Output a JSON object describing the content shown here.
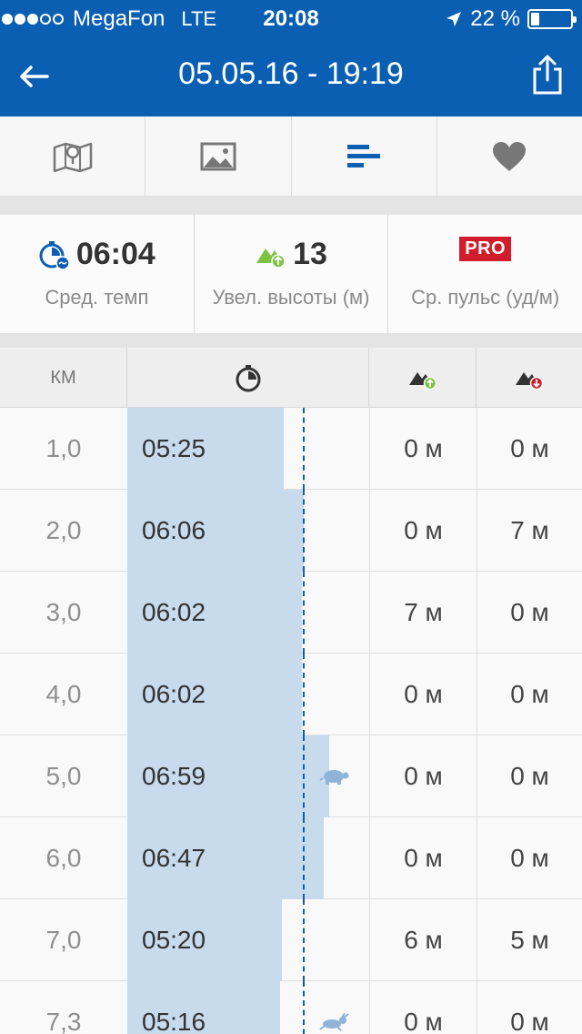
{
  "status_bar": {
    "carrier": "MegaFon",
    "network": "LTE",
    "time": "20:08",
    "battery_text": "22 %",
    "battery_level": 0.22,
    "signal_dots_filled": 3,
    "signal_dots_total": 5
  },
  "nav": {
    "title": "05.05.16 - 19:19",
    "back_icon": "back-arrow-icon",
    "share_icon": "share-icon"
  },
  "tabs": [
    {
      "icon": "map-icon",
      "active": false
    },
    {
      "icon": "photo-icon",
      "active": false
    },
    {
      "icon": "splits-icon",
      "active": true
    },
    {
      "icon": "heart-icon",
      "active": false
    }
  ],
  "summary": {
    "pace": {
      "value": "06:04",
      "label": "Сред. темп"
    },
    "elevation": {
      "value": "13",
      "label": "Увел. высоты (м)"
    },
    "heart_rate": {
      "badge": "PRO",
      "label": "Ср. пульс (уд/м)"
    }
  },
  "table": {
    "header_km": "КМ",
    "average_pace_seconds": 364,
    "rows": [
      {
        "km": "1,0",
        "pace": "05:25",
        "pace_seconds": 325,
        "up": "0 м",
        "down": "0 м",
        "marker": ""
      },
      {
        "km": "2,0",
        "pace": "06:06",
        "pace_seconds": 366,
        "up": "0 м",
        "down": "7 м",
        "marker": ""
      },
      {
        "km": "3,0",
        "pace": "06:02",
        "pace_seconds": 362,
        "up": "7 м",
        "down": "0 м",
        "marker": ""
      },
      {
        "km": "4,0",
        "pace": "06:02",
        "pace_seconds": 362,
        "up": "0 м",
        "down": "0 м",
        "marker": ""
      },
      {
        "km": "5,0",
        "pace": "06:59",
        "pace_seconds": 419,
        "up": "0 м",
        "down": "0 м",
        "marker": "turtle"
      },
      {
        "km": "6,0",
        "pace": "06:47",
        "pace_seconds": 407,
        "up": "0 м",
        "down": "0 м",
        "marker": ""
      },
      {
        "km": "7,0",
        "pace": "05:20",
        "pace_seconds": 320,
        "up": "6 м",
        "down": "5 м",
        "marker": ""
      },
      {
        "km": "7,3",
        "pace": "05:16",
        "pace_seconds": 316,
        "up": "0 м",
        "down": "0 м",
        "marker": "rabbit"
      }
    ]
  },
  "colors": {
    "brand_blue": "#0b5fb3",
    "bar_fill": "#c7dbed",
    "pro_red": "#d11d2b",
    "up_green": "#7dc243",
    "down_red": "#d11d2b"
  }
}
